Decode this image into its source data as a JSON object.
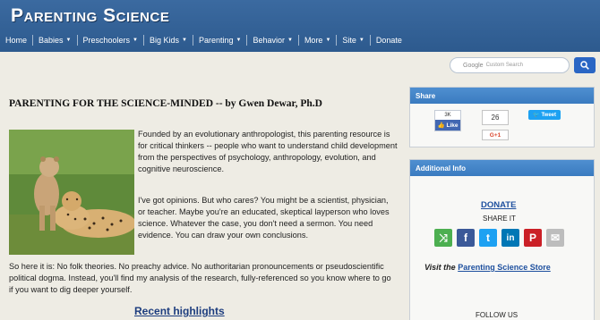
{
  "site": {
    "logo": "Parenting Science"
  },
  "nav": [
    {
      "label": "Home",
      "dropdown": false
    },
    {
      "label": "Babies",
      "dropdown": true
    },
    {
      "label": "Preschoolers",
      "dropdown": true
    },
    {
      "label": "Big Kids",
      "dropdown": true
    },
    {
      "label": "Parenting",
      "dropdown": true
    },
    {
      "label": "Behavior",
      "dropdown": true
    },
    {
      "label": "More",
      "dropdown": true
    },
    {
      "label": "Site",
      "dropdown": true
    },
    {
      "label": "Donate",
      "dropdown": false
    }
  ],
  "search": {
    "placeholder_brand": "Google",
    "placeholder": "Custom Search"
  },
  "main": {
    "title": "PARENTING FOR THE SCIENCE-MINDED -- by Gwen Dewar, Ph.D",
    "intro": "Founded by an evolutionary anthropologist, this parenting resource is for critical thinkers -- people who want to understand child development from the perspectives of psychology, anthropology, evolution, and cognitive neuroscience.",
    "opinion": "I've got opinions. But who cares? You might be a scientist, physician, or teacher. Maybe you're an educated, skeptical layperson who loves science. Whatever the case, you don't need a sermon. You need evidence. You can draw your own conclusions.",
    "summary": "So here it is: No folk theories. No preachy advice. No authoritarian pronouncements or pseudoscientific political dogma. Instead, you'll find my analysis of the research, fully-referenced so you know where to go if you want to dig deeper yourself.",
    "recent_highlights": "Recent highlights"
  },
  "share_panel": {
    "title": "Share",
    "fb_count": "3K",
    "fb_label": "Like",
    "count": "26",
    "gplus_label": "G+1",
    "tweet_label": "Tweet"
  },
  "info_panel": {
    "title": "Additional Info",
    "donate": "DONATE",
    "share_it": "SHARE IT",
    "visit_prefix": "Visit the",
    "visit_link": "Parenting Science Store",
    "follow_us": "FOLLOW US"
  },
  "share_icons": [
    {
      "name": "share-icon",
      "glyph": "⤨",
      "color": "#4caf50"
    },
    {
      "name": "facebook-icon",
      "glyph": "f",
      "color": "#3b5998"
    },
    {
      "name": "twitter-icon",
      "glyph": "t",
      "color": "#1da1f2"
    },
    {
      "name": "linkedin-icon",
      "glyph": "in",
      "color": "#0077b5"
    },
    {
      "name": "pinterest-icon",
      "glyph": "P",
      "color": "#cb2027"
    },
    {
      "name": "email-icon",
      "glyph": "✉",
      "color": "#bdbdbd"
    }
  ]
}
